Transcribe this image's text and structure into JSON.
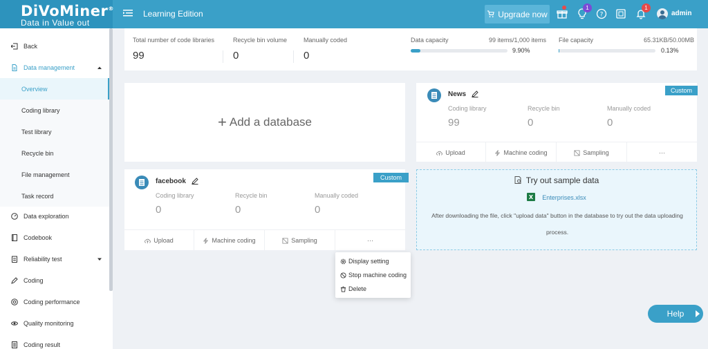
{
  "header": {
    "logo_main": "DiVoMiner",
    "logo_reg": "®",
    "logo_sub": "Data in  Value out",
    "edition": "Learning Edition",
    "upgrade_label": "Upgrade now",
    "bulb_badge": "1",
    "bell_badge": "1",
    "username": "admin"
  },
  "sidebar": {
    "back": "Back",
    "data_management": "Data management",
    "sub": [
      "Overview",
      "Coding library",
      "Test library",
      "Recycle bin",
      "File management",
      "Task record"
    ],
    "items": [
      "Data exploration",
      "Codebook",
      "Reliability test",
      "Coding",
      "Coding performance",
      "Quality monitoring",
      "Coding result"
    ]
  },
  "stats": {
    "libraries_label": "Total number of code libraries",
    "libraries_value": "99",
    "recycle_label": "Recycle bin volume",
    "recycle_value": "0",
    "manual_label": "Manually coded",
    "manual_value": "0",
    "data_cap_label": "Data capacity",
    "data_cap_value": "99 items/1,000 items",
    "data_cap_pct": "9.90%",
    "data_cap_fraction": 0.099,
    "file_cap_label": "File capacity",
    "file_cap_value": "65.31KB/50.00MB",
    "file_cap_pct": "0.13%",
    "file_cap_fraction": 0.0013
  },
  "add_database": "Add a database",
  "news": {
    "title": "News",
    "tag": "Custom",
    "coding_library_label": "Coding library",
    "coding_library_value": "99",
    "recycle_label": "Recycle bin",
    "recycle_value": "0",
    "manual_label": "Manually coded",
    "manual_value": "0",
    "actions": [
      "Upload",
      "Machine coding",
      "Sampling",
      "···"
    ]
  },
  "facebook": {
    "title": "facebook",
    "tag": "Custom",
    "coding_library_label": "Coding library",
    "coding_library_value": "0",
    "recycle_label": "Recycle bin",
    "recycle_value": "0",
    "manual_label": "Manually coded",
    "manual_value": "0",
    "actions": [
      "Upload",
      "Machine coding",
      "Sampling",
      "···"
    ]
  },
  "sample": {
    "title": "Try out sample data",
    "file": "Enterprises.xlsx",
    "desc": "After downloading the file, click \"upload data\" button in the database to try out the data uploading process."
  },
  "dropdown": [
    "Display setting",
    "Stop machine coding",
    "Delete"
  ],
  "help": "Help",
  "colors": {
    "accent": "#3aa0c8",
    "badge_purple": "#7b4bd6",
    "badge_red": "#e64a4a",
    "excel_green": "#1e7b45"
  }
}
